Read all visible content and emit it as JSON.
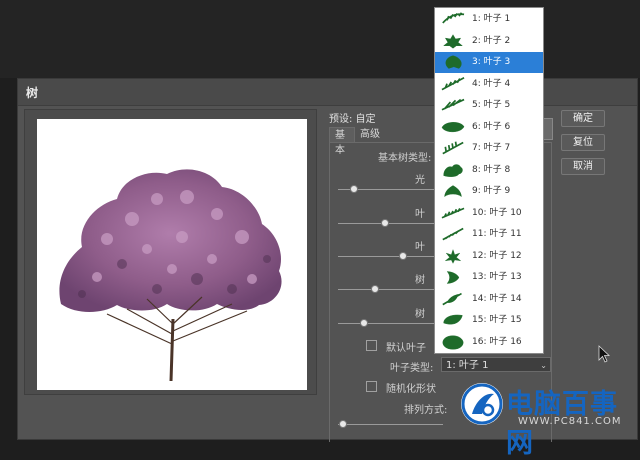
{
  "dialog": {
    "title": "树"
  },
  "preset": {
    "label": "预设: 自定"
  },
  "tabs": [
    {
      "label": "基本"
    },
    {
      "label": "高级"
    }
  ],
  "controls": {
    "tree_type_label": "基本树类型:",
    "row2_label": "光",
    "row3_label": "叶",
    "row4_label": "叶",
    "row5_label": "树",
    "row6_label": "树",
    "default_leaf_label": "默认叶子",
    "leaf_type_label": "叶子类型:",
    "leaf_type_value": "1: 叶子 1",
    "randomize_label": "随机化形状",
    "arrangement_label": "排列方式:",
    "slider_values": [
      0.15,
      0.45,
      0.62,
      0.35,
      0.25,
      0.05
    ]
  },
  "buttons": {
    "ok": "确定",
    "reset": "复位",
    "cancel": "取消"
  },
  "leaf_options": [
    "1: 叶子 1",
    "2: 叶子 2",
    "3: 叶子 3",
    "4: 叶子 4",
    "5: 叶子 5",
    "6: 叶子 6",
    "7: 叶子 7",
    "8: 叶子 8",
    "9: 叶子 9",
    "10: 叶子 10",
    "11: 叶子 11",
    "12: 叶子 12",
    "13: 叶子 13",
    "14: 叶子 14",
    "15: 叶子 15",
    "16: 叶子 16"
  ],
  "selected_leaf_index": 2,
  "colors": {
    "selection": "#2b7fd7",
    "leaf_green": "#1e6b2a",
    "tree_foliage": "#9a6a93"
  },
  "watermark": {
    "brand": "电脑百事网",
    "url": "WWW.PC841.COM"
  }
}
